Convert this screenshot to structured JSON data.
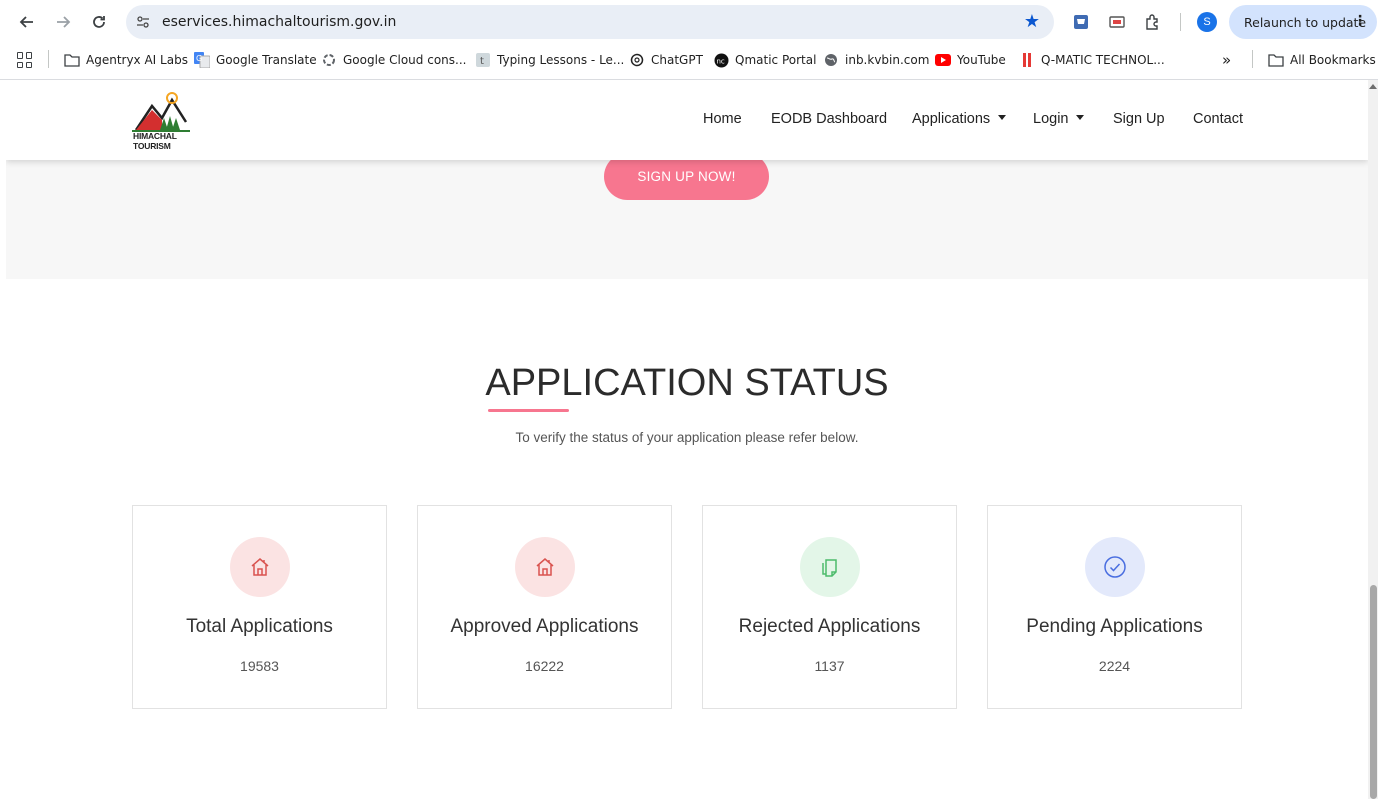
{
  "browser": {
    "url": "eservices.himachaltourism.gov.in",
    "profile_initial": "S",
    "relaunch_label": "Relaunch to update",
    "icons": [
      "back-arrow-icon",
      "forward-arrow-icon",
      "reload-icon",
      "site-info-icon",
      "bookmark-star-icon",
      "menu-dots-icon"
    ],
    "accent_color": "#0b57d0"
  },
  "bookmarks": {
    "items": [
      {
        "label": "Agentryx AI Labs",
        "icon": "folder-icon"
      },
      {
        "label": "Google Translate",
        "icon": "translate-icon"
      },
      {
        "label": "Google Cloud cons...",
        "icon": "cloud-icon"
      },
      {
        "label": "Typing Lessons - Le...",
        "icon": "typing-icon"
      },
      {
        "label": "ChatGPT",
        "icon": "chatgpt-icon"
      },
      {
        "label": "Qmatic Portal",
        "icon": "qmatic-icon"
      },
      {
        "label": "inb.kvbin.com",
        "icon": "globe-icon"
      },
      {
        "label": "YouTube",
        "icon": "youtube-icon"
      },
      {
        "label": "Q-MATIC TECHNOL...",
        "icon": "qmatic-tech-icon"
      }
    ],
    "overflow": "»",
    "all_bookmarks": "All Bookmarks"
  },
  "site": {
    "logo_line1": "HIMACHAL",
    "logo_line2": "TOURISM",
    "menu": {
      "home": "Home",
      "eodb": "EODB Dashboard",
      "applications": "Applications",
      "login": "Login",
      "signup": "Sign Up",
      "contact": "Contact"
    },
    "signup_button": "SIGN UP NOW!",
    "accent_color": "#f7768f"
  },
  "status_section": {
    "title": "APPLICATION STATUS",
    "subtitle": "To verify the status of your application please refer below.",
    "cards": [
      {
        "label": "Total Applications",
        "value": "19583",
        "icon": "house-icon",
        "color": "#d9534f",
        "bg": "#fbe3e3"
      },
      {
        "label": "Approved Applications",
        "value": "16222",
        "icon": "house-icon",
        "color": "#d9534f",
        "bg": "#fbe3e3"
      },
      {
        "label": "Rejected Applications",
        "value": "1137",
        "icon": "document-icon",
        "color": "#4cbb6b",
        "bg": "#e3f6e8"
      },
      {
        "label": "Pending Applications",
        "value": "2224",
        "icon": "check-circle-icon",
        "color": "#4a6ee0",
        "bg": "#e3e9fb"
      }
    ]
  }
}
